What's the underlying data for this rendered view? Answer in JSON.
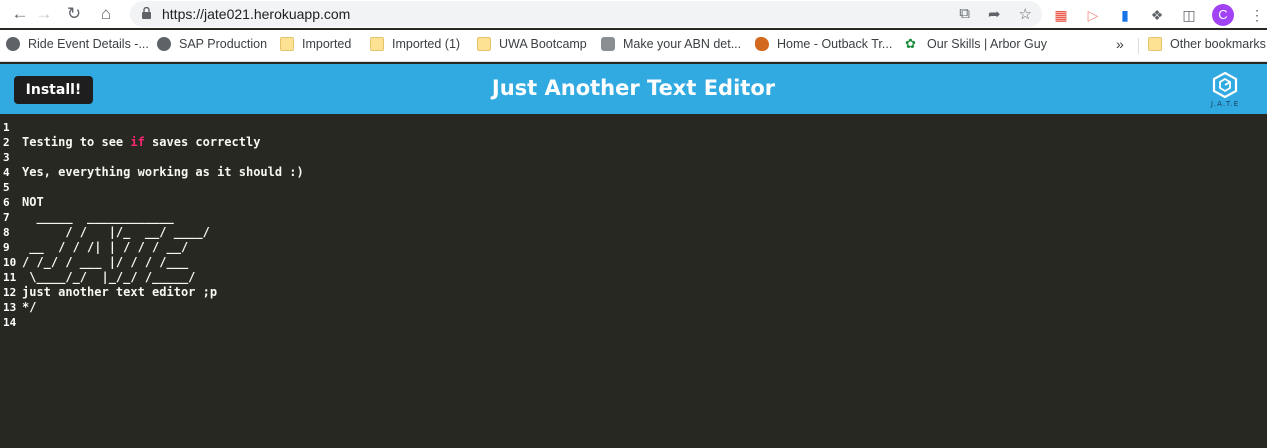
{
  "browser": {
    "url": "https://jate021.herokuapp.com",
    "profile_initial": "C"
  },
  "bookmarks": [
    {
      "label": "Ride Event Details -...",
      "icon": "globe-icon"
    },
    {
      "label": "SAP Production",
      "icon": "globe-icon"
    },
    {
      "label": "Imported",
      "icon": "folder-icon"
    },
    {
      "label": "Imported (1)",
      "icon": "folder-icon"
    },
    {
      "label": "UWA Bootcamp",
      "icon": "folder-icon"
    },
    {
      "label": "Make your ABN det...",
      "icon": "government-crest-icon"
    },
    {
      "label": "Home - Outback Tr...",
      "icon": "australia-map-icon"
    },
    {
      "label": "Our Skills | Arbor Guy",
      "icon": "palm-tree-icon"
    },
    {
      "label": "Other bookmarks",
      "icon": "folder-icon"
    }
  ],
  "app": {
    "install_label": "Install!",
    "title": "Just Another Text Editor",
    "logo_text": "J.A.T.E",
    "colors": {
      "header": "#31a9e1",
      "editor_bg": "#272822",
      "keyword": "#f92672"
    }
  },
  "editor": {
    "line_numbers": [
      "1",
      "2",
      "3",
      "4",
      "5",
      "6",
      "7",
      "8",
      "9",
      "10",
      "11",
      "12",
      "13",
      "14"
    ],
    "lines": [
      "",
      "Testing to see if saves correctly",
      "",
      "Yes, everything working as it should :)",
      "",
      "NOT",
      "  _____  ____________",
      "      / /   |/_  __/ ____/",
      " __  / / /| | / / / __/",
      "/ /_/ / ___ |/ / / /___",
      " \\____/_/  |_/_/ /_____/",
      "just another text editor ;p",
      "*/",
      ""
    ],
    "line2_parts": {
      "before": "Testing to see ",
      "keyword": "if",
      "after": " saves correctly"
    }
  }
}
